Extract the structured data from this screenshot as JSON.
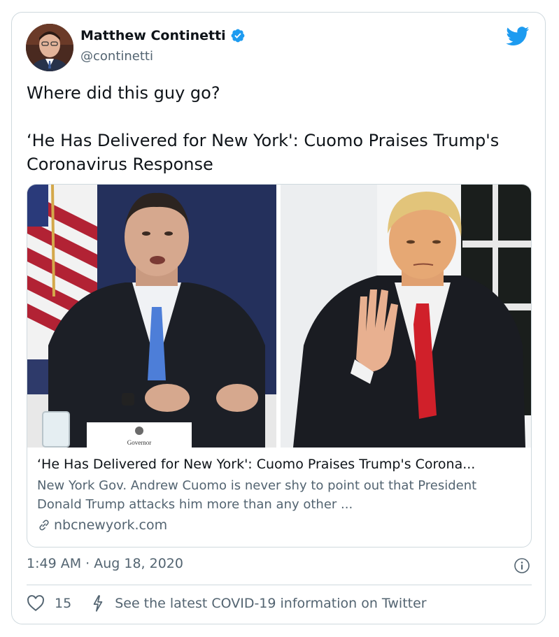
{
  "author": {
    "name": "Matthew Continetti",
    "handle": "@continetti",
    "verified": true
  },
  "tweet": {
    "line1": "Where did this guy go?",
    "line2": "‘He Has Delivered for New York': Cuomo Praises Trump's Coronavirus Response"
  },
  "link_card": {
    "title": "‘He Has Delivered for New York': Cuomo Praises Trump's Corona...",
    "description": "New York Gov. Andrew Cuomo is never shy to point out that President Donald Trump attacks him more than any other ...",
    "domain": "nbcnewyork.com",
    "nameplate": "Governor"
  },
  "meta": {
    "timestamp": "1:49 AM · Aug 18, 2020",
    "likes": "15",
    "covid_text": "See the latest COVID-19 information on Twitter"
  },
  "icons": {
    "brand": "twitter-bird-icon",
    "verified": "verified-badge-icon",
    "info": "info-icon",
    "like": "heart-icon",
    "covid": "lightning-icon",
    "link": "link-icon"
  },
  "colors": {
    "twitter_blue": "#1d9bf0",
    "text_primary": "#0f1419",
    "text_secondary": "#536471",
    "border": "#cfd9de"
  }
}
